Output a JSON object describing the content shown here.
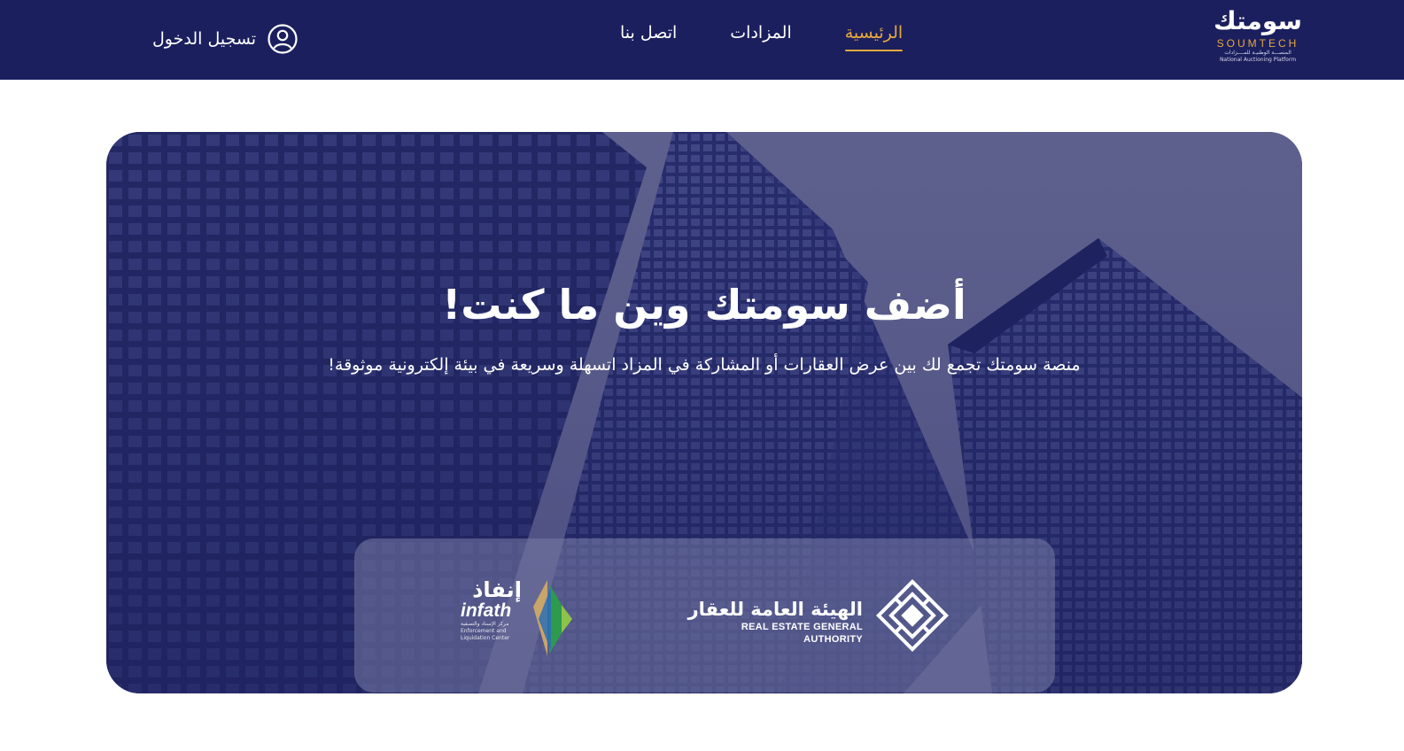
{
  "header": {
    "login_label": "تسجيل الدخول",
    "nav": [
      {
        "label": "اتصل بنا"
      },
      {
        "label": "المزادات"
      },
      {
        "label": "الرئيسية"
      }
    ],
    "active_nav": "الرئيسية",
    "logo": {
      "ar": "سومتك",
      "en": "SOUMTECH",
      "sub_ar": "المنصـــة الوطنيـة للمــــزادات",
      "sub_en": "National Auctioning Platform"
    }
  },
  "hero": {
    "title": "أضف سومتك وين ما كنت!",
    "subtitle": "منصة سومتك تجمع لك بين عرض العقارات أو المشاركة في المزاد اتسهلة وسريعة في بيئة إلكترونية موثوقة!"
  },
  "partners": {
    "rega_ar": "الهيئة العامة للعقار",
    "rega_en": "REAL ESTATE GENERAL AUTHORITY",
    "infath_ar": "إنفاذ",
    "infath_en": "infath",
    "infath_sub_ar": "مركز الإسناد والتصفية",
    "infath_sub_en": "Enforcement and Liquidation Center"
  },
  "colors": {
    "header_bg": "#1b1f5e",
    "accent": "#e8a93c",
    "hero_overlay": "#2a2f6e"
  },
  "icons": [
    "user-circle-icon",
    "rega-logo-mark",
    "infath-logo-mark"
  ]
}
